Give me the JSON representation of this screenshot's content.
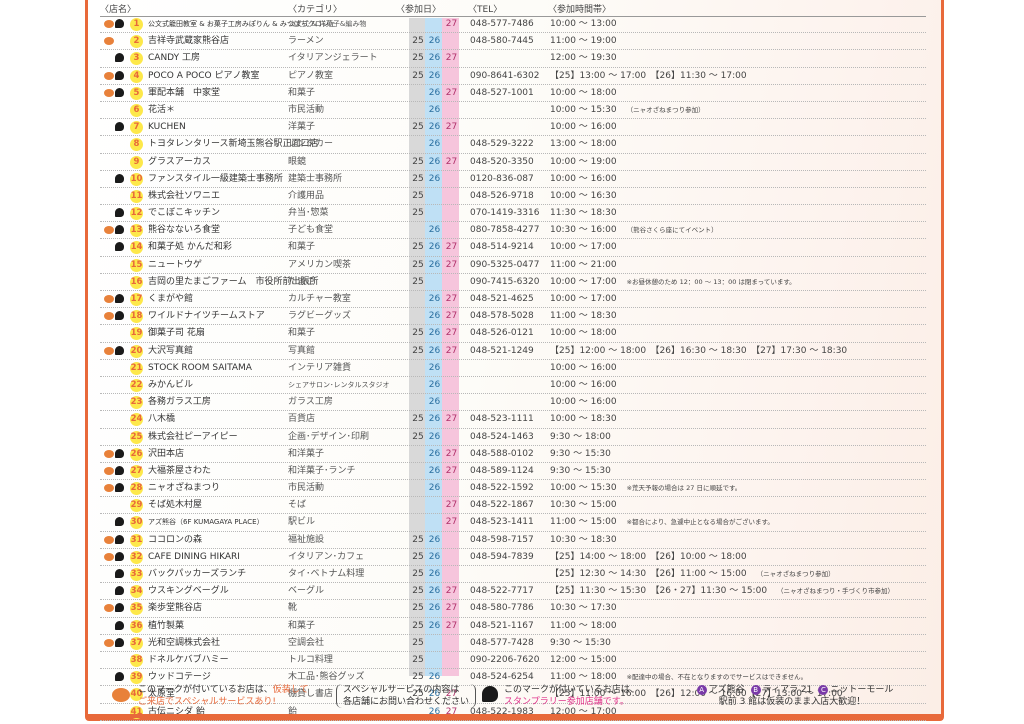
{
  "header": {
    "name": "〈店名〉",
    "category": "〈カテゴリ〉",
    "dates": "〈参加日〉",
    "tel": "〈TEL〉",
    "time": "〈参加時間帯〉"
  },
  "colors": {
    "frame": "#e8693a",
    "day25": "#d9d9d9",
    "day26": "#bfe0f5",
    "day27": "#f6c5dc",
    "number_badge": "#fde84a",
    "pumpkin": "#e8813a",
    "stamp_highlight": "#e0318a"
  },
  "rows": [
    {
      "no": "1",
      "pumpkin": true,
      "ghost": true,
      "name": "公文式籠田教室 & お菓子工房みぽりん & みつばちクロシェ",
      "cat": "公文式 & 洋菓子&編み物",
      "d25": "",
      "d26": "",
      "d27": "27",
      "tel": "048-577-7486",
      "time": "10:00 ～ 13:00",
      "note": ""
    },
    {
      "no": "2",
      "pumpkin": true,
      "ghost": false,
      "name": "吉祥寺武蔵家熊谷店",
      "cat": "ラーメン",
      "d25": "25",
      "d26": "26",
      "d27": "",
      "tel": "048-580-7445",
      "time": "11:00 ～ 19:00",
      "note": ""
    },
    {
      "no": "3",
      "pumpkin": false,
      "ghost": true,
      "name": "CANDY 工房",
      "cat": "イタリアンジェラート",
      "d25": "25",
      "d26": "26",
      "d27": "27",
      "tel": "",
      "time": "12:00 ～ 19:30",
      "note": ""
    },
    {
      "no": "4",
      "pumpkin": true,
      "ghost": true,
      "name": "POCO A POCO ピアノ教室",
      "cat": "ピアノ教室",
      "d25": "25",
      "d26": "26",
      "d27": "",
      "tel": "090-8641-6302",
      "time": "【25】13:00 ～ 17:00　【26】11:30 ～ 17:00",
      "note": ""
    },
    {
      "no": "5",
      "pumpkin": true,
      "ghost": true,
      "name": "軍配本舗　中家堂",
      "cat": "和菓子",
      "d25": "",
      "d26": "26",
      "d27": "27",
      "tel": "048-527-1001",
      "time": "10:00 ～ 18:00",
      "note": ""
    },
    {
      "no": "6",
      "pumpkin": false,
      "ghost": false,
      "name": "花活＊",
      "cat": "市民活動",
      "d25": "",
      "d26": "26",
      "d27": "",
      "tel": "",
      "time": "10:00 ～ 15:30",
      "note": "（ニャオざねまつり参加）"
    },
    {
      "no": "7",
      "pumpkin": false,
      "ghost": true,
      "name": "KUCHEN",
      "cat": "洋菓子",
      "d25": "25",
      "d26": "26",
      "d27": "27",
      "tel": "",
      "time": "10:00 ～ 16:00",
      "note": ""
    },
    {
      "no": "8",
      "pumpkin": false,
      "ghost": false,
      "name": "トヨタレンタリース新埼玉熊谷駅正面口店",
      "cat": "レンタカー",
      "d25": "",
      "d26": "26",
      "d27": "",
      "tel": "048-529-3222",
      "time": "13:00 ～ 18:00",
      "note": ""
    },
    {
      "no": "9",
      "pumpkin": false,
      "ghost": false,
      "name": "グラスアーカス",
      "cat": "眼鏡",
      "d25": "25",
      "d26": "26",
      "d27": "27",
      "tel": "048-520-3350",
      "time": "10:00 ～ 19:00",
      "note": ""
    },
    {
      "no": "10",
      "pumpkin": false,
      "ghost": true,
      "name": "ファンスタイル一級建築士事務所",
      "cat": "建築士事務所",
      "d25": "25",
      "d26": "26",
      "d27": "",
      "tel": "0120-836-087",
      "time": "10:00 ～ 16:00",
      "note": ""
    },
    {
      "no": "11",
      "pumpkin": false,
      "ghost": false,
      "name": "株式会社ソワニエ",
      "cat": "介護用品",
      "d25": "25",
      "d26": "",
      "d27": "",
      "tel": "048-526-9718",
      "time": "10:00 ～ 16:30",
      "note": ""
    },
    {
      "no": "12",
      "pumpkin": false,
      "ghost": true,
      "name": "でこぼこキッチン",
      "cat": "弁当･惣菜",
      "d25": "25",
      "d26": "",
      "d27": "",
      "tel": "070-1419-3316",
      "time": "11:30 ～ 18:30",
      "note": ""
    },
    {
      "no": "13",
      "pumpkin": true,
      "ghost": true,
      "name": "熊谷なないろ食堂",
      "cat": "子ども食堂",
      "d25": "",
      "d26": "26",
      "d27": "",
      "tel": "080-7858-4277",
      "time": "10:30 ～ 16:00",
      "note": "（熊谷さくら座にてイベント）"
    },
    {
      "no": "14",
      "pumpkin": false,
      "ghost": true,
      "name": "和菓子処 かんだ和彩",
      "cat": "和菓子",
      "d25": "25",
      "d26": "26",
      "d27": "27",
      "tel": "048-514-9214",
      "time": "10:00 ～ 17:00",
      "note": ""
    },
    {
      "no": "15",
      "pumpkin": false,
      "ghost": false,
      "name": "ニュートウゲ",
      "cat": "アメリカン喫茶",
      "d25": "25",
      "d26": "26",
      "d27": "27",
      "tel": "090-5325-0477",
      "time": "11:00 ～ 21:00",
      "note": ""
    },
    {
      "no": "16",
      "pumpkin": false,
      "ghost": false,
      "name": "吉岡の里たまごファーム　市役所前出張所",
      "cat": "たまご",
      "d25": "25",
      "d26": "",
      "d27": "",
      "tel": "090-7415-6320",
      "time": "10:00 ～ 17:00",
      "note": "※お昼休憩のため 12：00 ～ 13：00 は閉まっています。"
    },
    {
      "no": "17",
      "pumpkin": true,
      "ghost": true,
      "name": "くまがや館",
      "cat": "カルチャー教室",
      "d25": "",
      "d26": "26",
      "d27": "27",
      "tel": "048-521-4625",
      "time": "10:00 ～ 17:00",
      "note": ""
    },
    {
      "no": "18",
      "pumpkin": true,
      "ghost": true,
      "name": "ワイルドナイツチームストア",
      "cat": "ラグビーグッズ",
      "d25": "",
      "d26": "26",
      "d27": "27",
      "tel": "048-578-5028",
      "time": "11:00 ～ 18:30",
      "note": ""
    },
    {
      "no": "19",
      "pumpkin": false,
      "ghost": false,
      "name": "御菓子司 花扇",
      "cat": "和菓子",
      "d25": "25",
      "d26": "26",
      "d27": "27",
      "tel": "048-526-0121",
      "time": "10:00 ～ 18:00",
      "note": ""
    },
    {
      "no": "20",
      "pumpkin": true,
      "ghost": true,
      "name": "大沢写真館",
      "cat": "写真館",
      "d25": "25",
      "d26": "26",
      "d27": "27",
      "tel": "048-521-1249",
      "time": "【25】12:00 ～ 18:00　【26】16:30 ～ 18:30　【27】17:30 ～ 18:30",
      "note": ""
    },
    {
      "no": "21",
      "pumpkin": false,
      "ghost": false,
      "name": "STOCK ROOM SAITAMA",
      "cat": "インテリア雑貨",
      "d25": "",
      "d26": "26",
      "d27": "",
      "tel": "",
      "time": "10:00 ～ 16:00",
      "note": ""
    },
    {
      "no": "22",
      "pumpkin": false,
      "ghost": false,
      "name": "みかんビル",
      "cat": "シェアサロン･レンタルスタジオ",
      "d25": "",
      "d26": "26",
      "d27": "",
      "tel": "",
      "time": "10:00 ～ 16:00",
      "note": ""
    },
    {
      "no": "23",
      "pumpkin": false,
      "ghost": false,
      "name": "各務ガラス工房",
      "cat": "ガラス工房",
      "d25": "",
      "d26": "26",
      "d27": "",
      "tel": "",
      "time": "10:00 ～ 16:00",
      "note": ""
    },
    {
      "no": "24",
      "pumpkin": false,
      "ghost": false,
      "name": "八木橋",
      "cat": "百貨店",
      "d25": "25",
      "d26": "26",
      "d27": "27",
      "tel": "048-523-1111",
      "time": "10:00 ～ 18:30",
      "note": ""
    },
    {
      "no": "25",
      "pumpkin": false,
      "ghost": false,
      "name": "株式会社ピーアイピー",
      "cat": "企画･デザイン･印刷",
      "d25": "25",
      "d26": "26",
      "d27": "",
      "tel": "048-524-1463",
      "time": "9:30 ～ 18:00",
      "note": ""
    },
    {
      "no": "26",
      "pumpkin": true,
      "ghost": true,
      "name": "沢田本店",
      "cat": "和洋菓子",
      "d25": "",
      "d26": "26",
      "d27": "27",
      "tel": "048-588-0102",
      "time": "9:30 ～ 15:30",
      "note": ""
    },
    {
      "no": "27",
      "pumpkin": true,
      "ghost": true,
      "name": "大福茶屋さわた",
      "cat": "和洋菓子･ランチ",
      "d25": "",
      "d26": "26",
      "d27": "27",
      "tel": "048-589-1124",
      "time": "9:30 ～ 15:30",
      "note": ""
    },
    {
      "no": "28",
      "pumpkin": true,
      "ghost": true,
      "name": "ニャオざねまつり",
      "cat": "市民活動",
      "d25": "",
      "d26": "26",
      "d27": "",
      "tel": "048-522-1592",
      "time": "10:00 ～ 15:30",
      "note": "※荒天予報の場合は 27 日に順延です。"
    },
    {
      "no": "29",
      "pumpkin": false,
      "ghost": false,
      "name": "そば処木村屋",
      "cat": "そば",
      "d25": "",
      "d26": "",
      "d27": "27",
      "tel": "048-522-1867",
      "time": "10:30 ～ 15:00",
      "note": ""
    },
    {
      "no": "30",
      "pumpkin": false,
      "ghost": true,
      "name": "アズ熊谷（6F KUMAGAYA PLACE）",
      "cat": "駅ビル",
      "d25": "",
      "d26": "",
      "d27": "27",
      "tel": "048-523-1411",
      "time": "11:00 ～ 15:00",
      "note": "※都合により、急遽中止となる場合がございます。"
    },
    {
      "no": "31",
      "pumpkin": true,
      "ghost": true,
      "name": "ココロンの森",
      "cat": "福祉施設",
      "d25": "25",
      "d26": "26",
      "d27": "",
      "tel": "048-598-7157",
      "time": "10:30 ～ 18:30",
      "note": ""
    },
    {
      "no": "32",
      "pumpkin": true,
      "ghost": true,
      "name": "CAFE DINING HIKARI",
      "cat": "イタリアン･カフェ",
      "d25": "25",
      "d26": "26",
      "d27": "",
      "tel": "048-594-7839",
      "time": "【25】14:00 ～ 18:00　【26】10:00 ～ 18:00",
      "note": ""
    },
    {
      "no": "33",
      "pumpkin": false,
      "ghost": true,
      "name": "バックパッカーズランチ",
      "cat": "タイ･ベトナム料理",
      "d25": "25",
      "d26": "26",
      "d27": "",
      "tel": "",
      "time": "【25】12:30 ～ 14:30　【26】11:00 ～ 15:00",
      "note": "（ニャオざねまつり参加）"
    },
    {
      "no": "34",
      "pumpkin": false,
      "ghost": true,
      "name": "ウスキングベーグル",
      "cat": "ベーグル",
      "d25": "25",
      "d26": "26",
      "d27": "27",
      "tel": "048-522-7717",
      "time": "【25】11:30 ～ 15:30　【26・27】11:30 ～ 15:00",
      "note": "（ニャオざねまつり・手づくり市参加）"
    },
    {
      "no": "35",
      "pumpkin": true,
      "ghost": true,
      "name": "楽歩堂熊谷店",
      "cat": "靴",
      "d25": "25",
      "d26": "26",
      "d27": "27",
      "tel": "048-580-7786",
      "time": "10:30 ～ 17:30",
      "note": ""
    },
    {
      "no": "36",
      "pumpkin": false,
      "ghost": true,
      "name": "植竹製菓",
      "cat": "和菓子",
      "d25": "25",
      "d26": "26",
      "d27": "27",
      "tel": "048-521-1167",
      "time": "11:00 ～ 18:00",
      "note": ""
    },
    {
      "no": "37",
      "pumpkin": true,
      "ghost": true,
      "name": "光和空調株式会社",
      "cat": "空調会社",
      "d25": "25",
      "d26": "",
      "d27": "",
      "tel": "048-577-7428",
      "time": "9:30 ～ 15:30",
      "note": ""
    },
    {
      "no": "38",
      "pumpkin": false,
      "ghost": false,
      "name": "ドネルケバブハミー",
      "cat": "トルコ料理",
      "d25": "25",
      "d26": "",
      "d27": "",
      "tel": "090-2206-7620",
      "time": "12:00 ～ 15:00",
      "note": ""
    },
    {
      "no": "39",
      "pumpkin": false,
      "ghost": true,
      "name": "ウッドコテージ",
      "cat": "木工品･熊谷グッズ",
      "d25": "25",
      "d26": "26",
      "d27": "",
      "tel": "048-524-6254",
      "time": "11:00 ～ 18:00",
      "note": "※配達中の場合、不在となりますのでサービスはできません。"
    },
    {
      "no": "40",
      "pumpkin": false,
      "ghost": true,
      "name": "太原堂",
      "cat": "棚貸し書店",
      "d25": "25",
      "d26": "26",
      "d27": "27",
      "tel": "",
      "time": "【25】11:00 ～ 16:00　【26】12:00 ～ 16:00【27】13:00 ～ 17:00",
      "note": ""
    },
    {
      "no": "41",
      "pumpkin": false,
      "ghost": false,
      "name": "古伝ニシダ 飴",
      "cat": "飴",
      "d25": "",
      "d26": "26",
      "d27": "27",
      "tel": "048-522-1983",
      "time": "12:00 ～ 17:00",
      "note": ""
    }
  ],
  "footer": {
    "pumpkin_line1_a": "このマークが付いているお店は、",
    "pumpkin_line1_b": "仮装して",
    "pumpkin_line2": "ご来店でスペシャルサービスあり!",
    "special_line1": "スペシャルサービスの内容は",
    "special_line2": "各店舗にお問い合わせください",
    "ghost_line1": "このマークが付いているお店は、",
    "ghost_line2": "スタンプラリー参加店舗です。",
    "stations": [
      {
        "badge": "A",
        "label": "アズ熊谷"
      },
      {
        "badge": "B",
        "label": "ティアラ 21"
      },
      {
        "badge": "C",
        "label": "ニットーモール"
      }
    ],
    "stations_note": "駅前 3 館は仮装のまま入店大歓迎！"
  }
}
